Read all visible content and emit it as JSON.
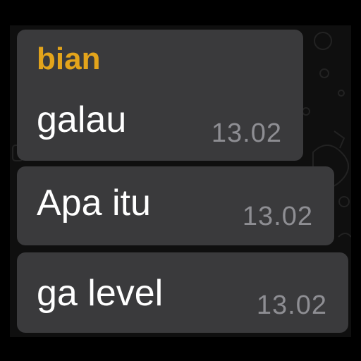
{
  "messages": [
    {
      "sender": "bian",
      "text": "galau",
      "time": "13.02"
    },
    {
      "text": "Apa itu",
      "time": "13.02"
    },
    {
      "text": "ga level",
      "time": "13.02"
    }
  ],
  "colors": {
    "background": "#0f0f0f",
    "bubble": "#3a3a3c",
    "sender_name": "#e3a41b",
    "message_text": "#ffffff",
    "timestamp": "#8e8e93"
  }
}
